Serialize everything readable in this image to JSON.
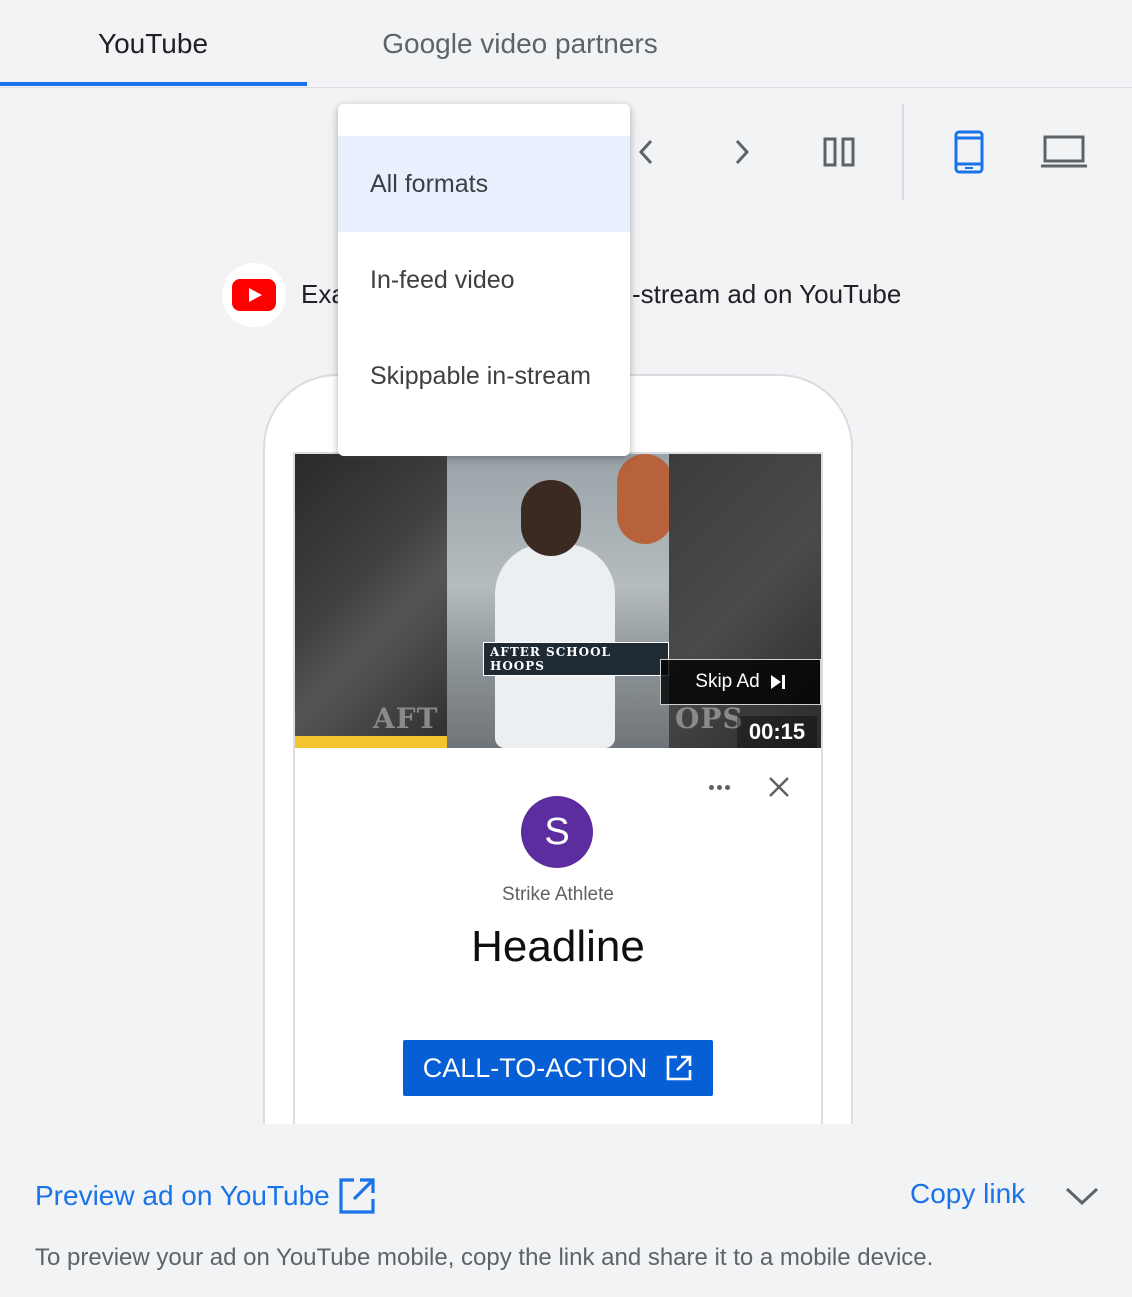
{
  "tabs": [
    {
      "label": "YouTube",
      "selected": true
    },
    {
      "label": "Google video partners",
      "selected": false
    }
  ],
  "toolbar": {
    "icons": [
      "chevron-left-icon",
      "chevron-right-icon",
      "side-by-side-icon",
      "mobile-icon",
      "desktop-icon"
    ],
    "active_device": "mobile"
  },
  "caption": {
    "text": "Example of a skippable in-stream ad on YouTube",
    "visible_prefix": "Exa",
    "visible_suffix": "-stream ad on YouTube"
  },
  "format_menu": {
    "items": [
      "All formats",
      "In-feed video",
      "Skippable in-stream"
    ],
    "selected": "All formats"
  },
  "video": {
    "watermark": "AFTER SCHOOL HOOPS",
    "watermark_left_fragment": "AFT",
    "watermark_right_fragment": "OPS",
    "skip_label": "Skip Ad",
    "timer": "00:15"
  },
  "ad": {
    "avatar_letter": "S",
    "advertiser": "Strike Athlete",
    "headline": "Headline",
    "cta_label": "CALL-TO-ACTION"
  },
  "footer": {
    "preview_label": "Preview ad on YouTube",
    "copy_label": "Copy link",
    "help_text": "To preview your ad on YouTube mobile, copy the link and share it to a mobile device."
  },
  "colors": {
    "accent": "#1a73e8",
    "cta": "#065fd4",
    "avatar": "#5c2d9e",
    "progress": "#f4c430",
    "youtube_red": "#ff0000"
  }
}
